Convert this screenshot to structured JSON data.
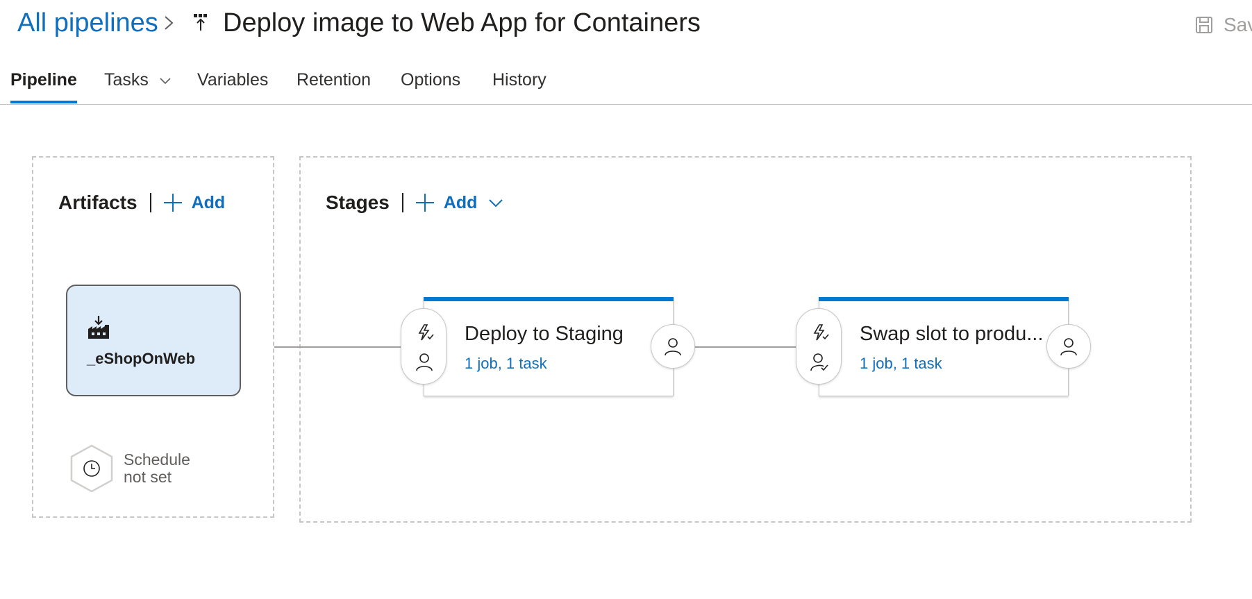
{
  "header": {
    "breadcrumb": "All pipelines",
    "title": "Deploy image to Web App for Containers",
    "save_label": "Save"
  },
  "tabs": [
    {
      "label": "Pipeline",
      "active": true
    },
    {
      "label": "Tasks",
      "has_dropdown": true
    },
    {
      "label": "Variables"
    },
    {
      "label": "Retention"
    },
    {
      "label": "Options"
    },
    {
      "label": "History"
    }
  ],
  "artifacts": {
    "title": "Artifacts",
    "add_label": "Add",
    "items": [
      {
        "name": "_eShopOnWeb",
        "icon": "build-artifact-icon"
      }
    ],
    "schedule": {
      "line1": "Schedule",
      "line2": "not set",
      "icon": "clock-icon"
    }
  },
  "stages": {
    "title": "Stages",
    "add_label": "Add",
    "items": [
      {
        "name": "Deploy to Staging",
        "meta": "1 job, 1 task",
        "pre_icons": [
          "trigger-icon",
          "user-icon"
        ],
        "post_icon": "user-icon"
      },
      {
        "name": "Swap slot to produ...",
        "meta": "1 job, 1 task",
        "pre_icons": [
          "trigger-icon",
          "approved-user-icon"
        ],
        "post_icon": "user-icon"
      }
    ]
  },
  "colors": {
    "accent": "#0078d4",
    "link": "#106ebe",
    "artifact_bg": "#deecf9"
  }
}
